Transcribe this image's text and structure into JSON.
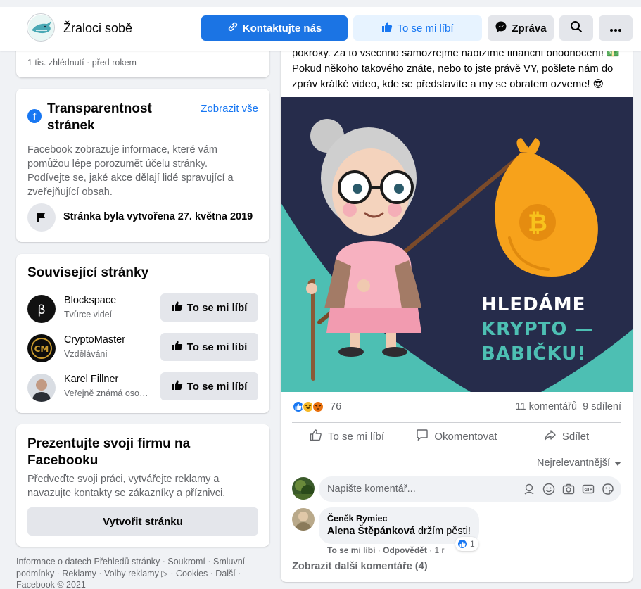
{
  "header": {
    "page_name": "Žraloci sobě",
    "contact_label": "Kontaktujte nás",
    "like_label": "To se mi líbí",
    "message_label": "Zpráva"
  },
  "video_card": {
    "meta": "1 tis. zhlédnutí · před rokem"
  },
  "transparency": {
    "title": "Transparentnost stránek",
    "see_all": "Zobrazit vše",
    "description": "Facebook zobrazuje informace, které vám pomůžou lépe porozumět účelu stránky. Podívejte se, jaké akce dělají lidé spravující a zveřejňující obsah.",
    "created": "Stránka byla vytvořena 27. května 2019"
  },
  "related": {
    "title": "Související stránky",
    "like_label": "To se mi líbí",
    "items": [
      {
        "name": "Blockspace",
        "category": "Tvůrce videí"
      },
      {
        "name": "CryptoMaster",
        "category": "Vzdělávání"
      },
      {
        "name": "Karel Fillner",
        "category": "Veřejně známá osobnost"
      }
    ]
  },
  "promo": {
    "title": "Prezentujte svoji firmu na Facebooku",
    "description": "Předveďte svoji práci, vytvářejte reklamy a navazujte kontakty se zákazníky a příznivci.",
    "button": "Vytvořit stránku"
  },
  "footer": {
    "text": "Informace o datech Přehledů stránky · Soukromí · Smluvní podmínky · Reklamy · Volby reklamy ▷ · Cookies · Další · Facebook © 2021"
  },
  "post": {
    "text": "pokroky. Za to všechno samozřejmě nabízíme finanční ohodnocení! 💵 Pokud někoho takového znáte, nebo to jste právě VY, pošlete nám do zpráv krátké video, kde se představíte a my se obratem ozveme! 😎",
    "image_line1": "HLEDÁME",
    "image_line2": "KRYPTO —",
    "image_line3": "BABIČKU!",
    "reaction_count": "76",
    "comments_count": "11 komentářů",
    "shares_count": "9 sdílení",
    "like_action": "To se mi líbí",
    "comment_action": "Okomentovat",
    "share_action": "Sdílet",
    "sort_label": "Nejrelevantnější",
    "comment_placeholder": "Napište komentář...",
    "comment": {
      "author": "Čeněk Rymiec",
      "tag": "Alena Štěpánková",
      "text": " držím pěsti!",
      "like_link": "To se mi líbí",
      "reply_link": "Odpovědět",
      "time": "1 r",
      "react_count": "1"
    },
    "more_comments": "Zobrazit další komentáře (4)"
  },
  "colors": {
    "primary": "#1b74e4",
    "image_bg": "#262c4b",
    "image_teal": "#4dbfb3",
    "bitcoin_orange": "#f7a21b"
  }
}
